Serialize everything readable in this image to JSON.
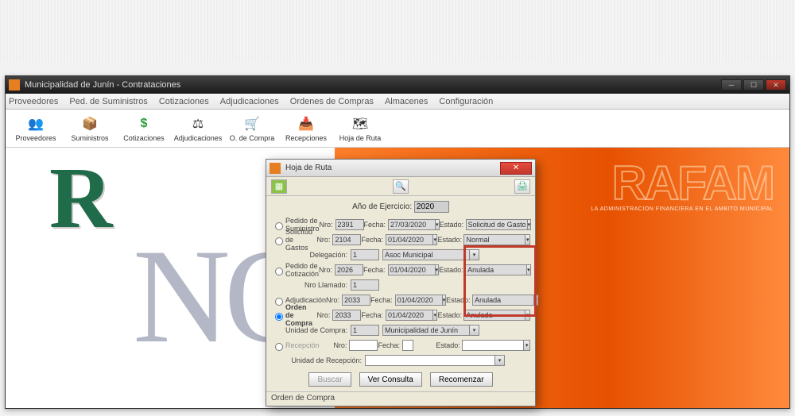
{
  "window": {
    "title": "Municipalidad de Junín - Contrataciones"
  },
  "menu": {
    "m1": "Proveedores",
    "m2": "Ped. de Suministros",
    "m3": "Cotizaciones",
    "m4": "Adjudicaciones",
    "m5": "Ordenes de Compras",
    "m6": "Almacenes",
    "m7": "Configuración"
  },
  "toolbar": {
    "t1": "Proveedores",
    "t2": "Suministros",
    "t3": "Cotizaciones",
    "t4": "Adjudicaciones",
    "t5": "O. de Compra",
    "t6": "Recepciones",
    "t7": "Hoja de Ruta"
  },
  "bg": {
    "rafam": "RAFAM",
    "rafam_sub": "LA ADMINISTRACION FINANCIERA EN EL AMBITO MUNICIPAL"
  },
  "dlg": {
    "title": "Hoja de Ruta",
    "year_label": "Año de Ejercicio:",
    "year": "2020",
    "labels": {
      "pedsum": "Pedido de Suministro",
      "solgas": "Solicitud de Gastos",
      "deleg": "Delegación:",
      "pedcot": "Pedido de Cotización",
      "nrollam": "Nro Llamado:",
      "adj": "Adjudicación",
      "oc": "Orden de Compra",
      "unicom": "Unidad de Compra:",
      "rec": "Recepción",
      "unirec": "Unidad de Recepción:",
      "nro": "Nro:",
      "fecha": "Fecha:",
      "estado": "Estado:"
    },
    "vals": {
      "pedsum_nro": "2391",
      "pedsum_fecha": "27/03/2020",
      "pedsum_estado": "Solicitud de Gasto",
      "solgas_nro": "2104",
      "solgas_fecha": "01/04/2020",
      "solgas_estado": "Normal",
      "deleg_nro": "1",
      "deleg_desc": "Asoc Municipal",
      "pedcot_nro": "2026",
      "pedcot_fecha": "01/04/2020",
      "pedcot_estado": "Anulada",
      "nrollam": "1",
      "adj_nro": "2033",
      "adj_fecha": "01/04/2020",
      "adj_estado": "Anulada",
      "oc_nro": "2033",
      "oc_fecha": "01/04/2020",
      "oc_estado": "Anulada",
      "unicom_nro": "1",
      "unicom_desc": "Municipalidad de Junín",
      "rec_nro": "",
      "rec_fecha": "",
      "rec_estado": "",
      "unirec": ""
    },
    "buttons": {
      "buscar": "Buscar",
      "ver": "Ver Consulta",
      "recom": "Recomenzar"
    },
    "status": "Orden de Compra"
  }
}
